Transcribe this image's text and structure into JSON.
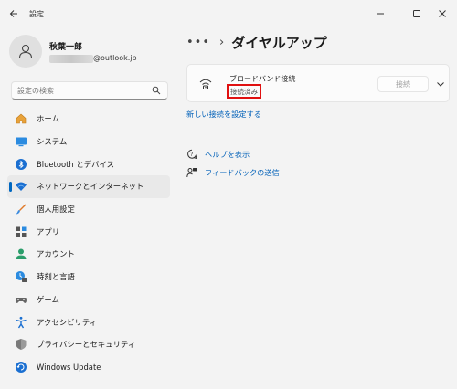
{
  "window": {
    "title": "設定"
  },
  "profile": {
    "name": "秋葉一郎",
    "email_suffix": "@outlook.jp"
  },
  "search": {
    "placeholder": "設定の検索"
  },
  "nav": {
    "items": [
      {
        "label": "ホーム",
        "icon": "home-icon"
      },
      {
        "label": "システム",
        "icon": "system-icon"
      },
      {
        "label": "Bluetooth とデバイス",
        "icon": "bluetooth-icon"
      },
      {
        "label": "ネットワークとインターネット",
        "icon": "network-icon",
        "active": true
      },
      {
        "label": "個人用設定",
        "icon": "brush-icon"
      },
      {
        "label": "アプリ",
        "icon": "apps-icon"
      },
      {
        "label": "アカウント",
        "icon": "account-icon"
      },
      {
        "label": "時刻と言語",
        "icon": "time-language-icon"
      },
      {
        "label": "ゲーム",
        "icon": "gaming-icon"
      },
      {
        "label": "アクセシビリティ",
        "icon": "accessibility-icon"
      },
      {
        "label": "プライバシーとセキュリティ",
        "icon": "shield-icon"
      },
      {
        "label": "Windows Update",
        "icon": "windows-update-icon"
      }
    ]
  },
  "main": {
    "breadcrumb_more": "•••",
    "breadcrumb_sep": "›",
    "title": "ダイヤルアップ",
    "connection": {
      "name": "ブロードバンド接続",
      "status": "接続済み",
      "connect_label": "接続"
    },
    "new_connection_link": "新しい接続を設定する",
    "help": {
      "show_help": "ヘルプを表示",
      "feedback": "フィードバックの送信"
    }
  },
  "colors": {
    "accent": "#0067c0",
    "link": "#0060b8",
    "highlight_box": "#e01010"
  }
}
